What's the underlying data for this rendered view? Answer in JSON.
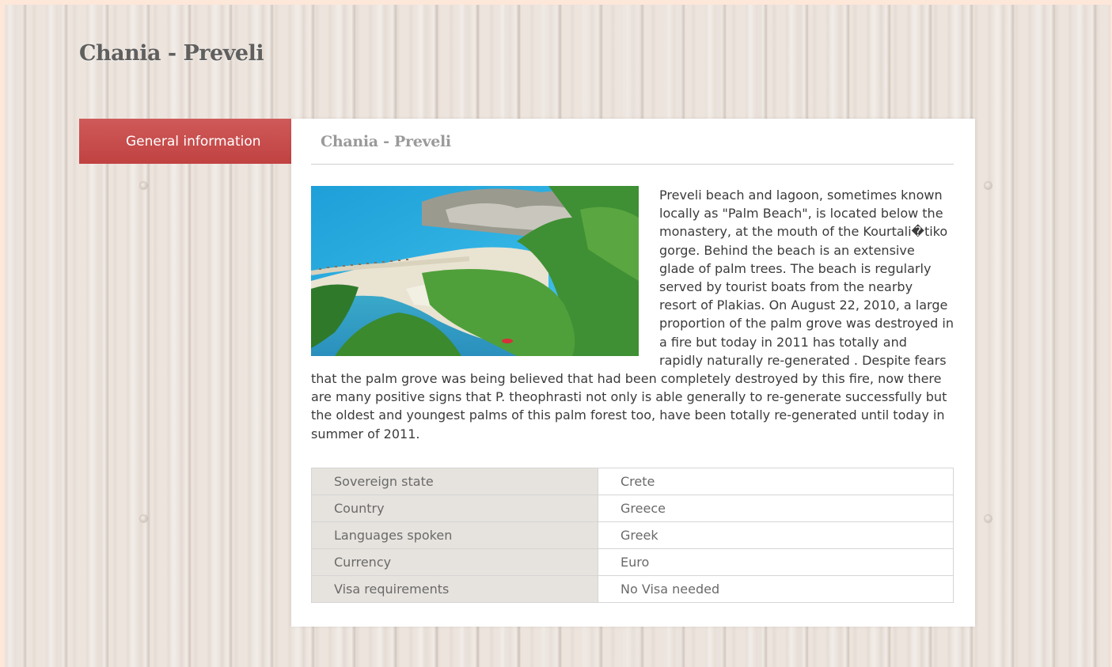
{
  "page": {
    "title": "Chania - Preveli"
  },
  "tab": {
    "label": "General information"
  },
  "card": {
    "title": "Chania - Preveli",
    "image_description": "Aerial view of Preveli palm beach, river and lagoon",
    "description": "Preveli beach and lagoon, sometimes known locally as \"Palm Beach\", is located below the monastery, at the mouth of the Kourtali�tiko gorge. Behind the beach is an extensive glade of palm trees. The beach is regularly served by tourist boats from the nearby resort of Plakias. On August 22, 2010, a large proportion of the palm grove was destroyed in a fire but today in 2011 has totally and rapidly naturally re-generated . Despite fears that the palm grove was being believed that had been completely destroyed by this fire, now there are many positive signs that P. theophrasti not only is able generally to re-generate successfully but the oldest and youngest palms of this palm forest too, have been totally re-generated until today in summer of 2011."
  },
  "info_table": [
    {
      "label": "Sovereign state",
      "value": "Crete"
    },
    {
      "label": "Country",
      "value": "Greece"
    },
    {
      "label": "Languages spoken",
      "value": "Greek"
    },
    {
      "label": "Currency",
      "value": "Euro"
    },
    {
      "label": "Visa requirements",
      "value": "No Visa needed"
    }
  ],
  "colors": {
    "accent": "#c8494a",
    "title_text": "#5f5f5f",
    "card_title_text": "#9a9a9a",
    "table_key_bg": "#e6e3de"
  }
}
